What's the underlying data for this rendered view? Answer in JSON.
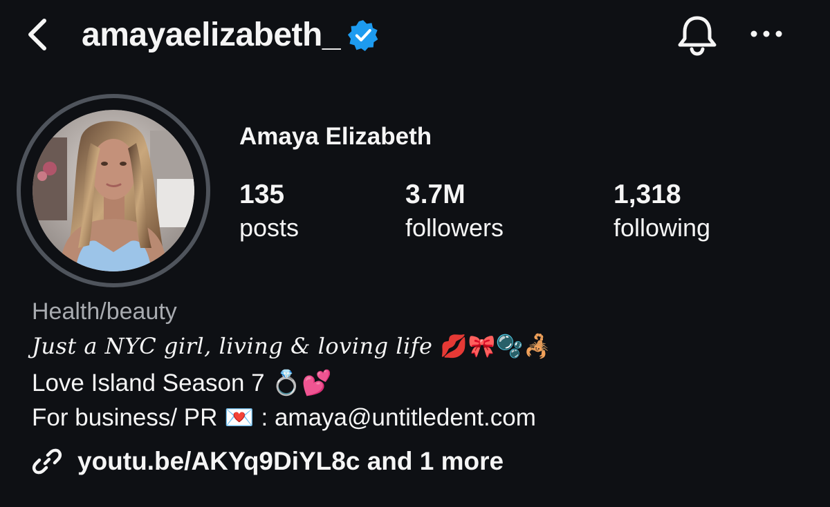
{
  "header": {
    "username": "amayaelizabeth_",
    "back_icon": "chevron-left-icon",
    "verified_icon": "verified-badge-icon",
    "verified_color": "#1d9bf0",
    "notifications_icon": "bell-icon",
    "more_icon": "more-horizontal-icon"
  },
  "profile": {
    "display_name": "Amaya Elizabeth",
    "stats": {
      "posts": {
        "count": "135",
        "label": "posts"
      },
      "followers": {
        "count": "3.7M",
        "label": "followers"
      },
      "following": {
        "count": "1,318",
        "label": "following"
      }
    }
  },
  "bio": {
    "category": "Health/beauty",
    "line1_text": "Just a NYC girl, living & loving life",
    "line1_emoji": "💋🎀🫧🦂",
    "line2_text": "Love Island Season 7",
    "line2_emoji": "💍💕",
    "line3_prefix": "For business/ PR",
    "line3_emoji": "💌",
    "line3_suffix": ": amaya@untitledent.com"
  },
  "link": {
    "icon": "link-icon",
    "text": "youtu.be/AKYq9DiYL8c and 1 more"
  },
  "colors": {
    "background": "#0e1014",
    "text": "#f5f5f5",
    "muted": "#a8abb0",
    "avatar_ring": "#4f545c"
  }
}
